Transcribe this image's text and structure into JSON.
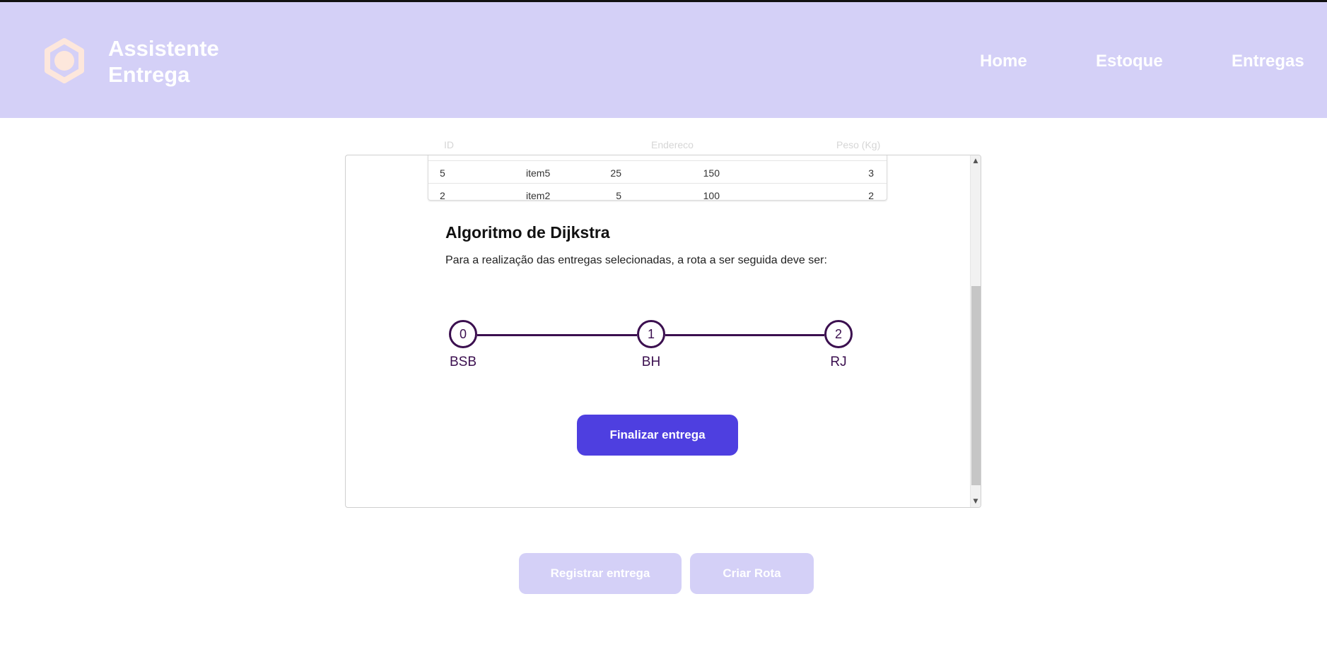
{
  "brand": {
    "line1": "Assistente",
    "line2": "Entrega"
  },
  "nav": {
    "home": "Home",
    "stock": "Estoque",
    "deliveries": "Entregas"
  },
  "table": {
    "headers": {
      "id": "ID",
      "address": "Endereco",
      "weight": "Peso (Kg)"
    },
    "rows": [
      {
        "id": "5",
        "item": "item5",
        "c3": "25",
        "c4": "150",
        "c5": "3"
      },
      {
        "id": "2",
        "item": "item2",
        "c3": "5",
        "c4": "100",
        "c5": "2"
      }
    ]
  },
  "dijkstra": {
    "title": "Algoritmo de Dijkstra",
    "description": "Para a realização das entregas selecionadas, a rota a ser seguida deve ser:",
    "route": [
      {
        "index": "0",
        "city": "BSB"
      },
      {
        "index": "1",
        "city": "BH"
      },
      {
        "index": "2",
        "city": "RJ"
      }
    ],
    "finalize_label": "Finalizar entrega"
  },
  "actions": {
    "register_label": "Registrar entrega",
    "route_label": "Criar Rota"
  },
  "colors": {
    "header_bg": "#d4d0f7",
    "primary": "#4e3fe0",
    "route": "#3b0f4f",
    "logo": "#fde7dc"
  },
  "icons": {
    "logo": "hexagon-logo-icon",
    "scroll_up": "chevron-up-icon",
    "scroll_down": "chevron-down-icon"
  }
}
